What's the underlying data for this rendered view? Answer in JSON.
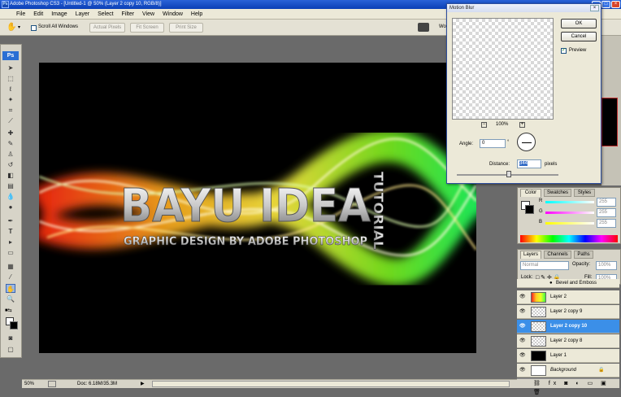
{
  "window": {
    "title": "Adobe Photoshop CS3 - [Untitled-1 @ 50% (Layer 2 copy 10, RGB/8)]",
    "logo_text": "Ps"
  },
  "menu": [
    "File",
    "Edit",
    "Image",
    "Layer",
    "Select",
    "Filter",
    "View",
    "Window",
    "Help"
  ],
  "options": {
    "scroll_all_label": "Scroll All Windows",
    "actual_pixels": "Actual Pixels",
    "fit_screen": "Fit Screen",
    "print_size": "Print Size",
    "workspace": "Wo"
  },
  "toolbox": {
    "badge": "Ps"
  },
  "canvas": {
    "main_text": "BAYU IDEA",
    "sub_text": "GRAPHIC DESIGN BY ADOBE PHOTOSHOP",
    "vertical_text": "TUTORIAL"
  },
  "status": {
    "zoom": "50%",
    "doc": "Doc: 6.18M/35.3M"
  },
  "dialog": {
    "title": "Motion Blur",
    "ok": "OK",
    "cancel": "Cancel",
    "preview_label": "Preview",
    "preview_checked": true,
    "zoom": "100%",
    "angle_label": "Angle:",
    "angle_value": "0",
    "degree": "°",
    "distance_label": "Distance:",
    "distance_value": "344",
    "distance_unit": "pixels"
  },
  "color_panel": {
    "tabs": [
      "Color",
      "Swatches",
      "Styles"
    ],
    "r_label": "R",
    "g_label": "G",
    "b_label": "B",
    "r": "255",
    "g": "255",
    "b": "255"
  },
  "layers_panel": {
    "tabs": [
      "Layers",
      "Channels",
      "Paths"
    ],
    "blend_mode": "Normal",
    "opacity_label": "Opacity:",
    "opacity": "100%",
    "lock_label": "Lock:",
    "fill_label": "Fill:",
    "fill": "100%",
    "effect": "Bevel and Emboss",
    "layers": [
      {
        "name": "Layer 2",
        "selected": false
      },
      {
        "name": "Layer 2 copy 9",
        "selected": false
      },
      {
        "name": "Layer 2 copy 10",
        "selected": true
      },
      {
        "name": "Layer 2 copy 8",
        "selected": false
      },
      {
        "name": "Layer 1",
        "selected": false
      },
      {
        "name": "Background",
        "selected": false
      }
    ]
  },
  "colors": {
    "accent": "#3b8fe8",
    "title_blue": "#0b3fb5",
    "canvas": "#000000"
  }
}
